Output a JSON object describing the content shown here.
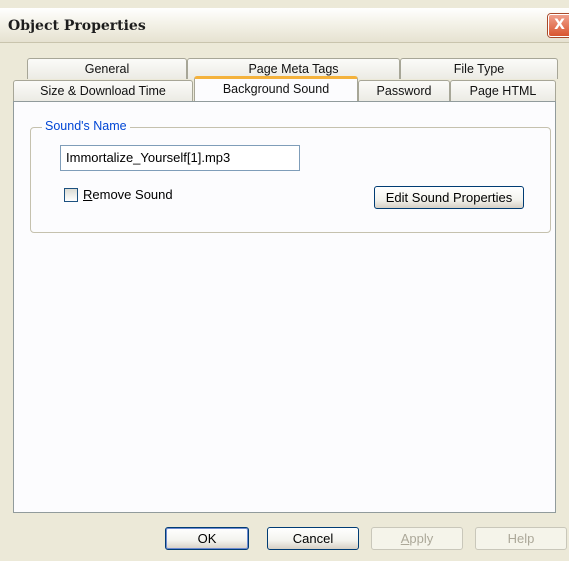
{
  "window": {
    "title": "Object Properties",
    "close_glyph": "X"
  },
  "tabs": {
    "row1": [
      "General",
      "Page Meta Tags",
      "File Type"
    ],
    "row2": [
      "Size & Download Time",
      "Background Sound",
      "Password",
      "Page HTML"
    ],
    "active": "Background Sound"
  },
  "sound_group": {
    "label": "Sound's Name",
    "file_name": "Immortalize_Yourself[1].mp3",
    "remove_checkbox": {
      "accel": "R",
      "rest": "emove Sound",
      "checked": false
    },
    "edit_button": "Edit Sound Properties"
  },
  "buttons": {
    "ok": "OK",
    "cancel": "Cancel",
    "apply_accel": "A",
    "apply_rest": "pply",
    "help": "Help"
  },
  "icons": {
    "close": "close-icon",
    "checkbox": "checkbox-icon"
  }
}
